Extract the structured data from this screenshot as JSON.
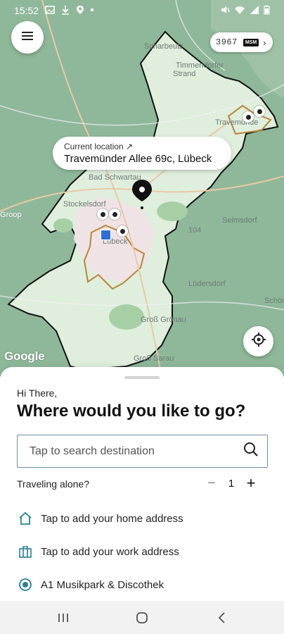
{
  "status_bar": {
    "time": "15:52",
    "left_icons": [
      "image-icon",
      "download-icon",
      "location-icon",
      "dot-icon"
    ],
    "right_icons": [
      "mute-icon",
      "wifi-icon",
      "signal-icon",
      "battery-icon"
    ]
  },
  "map": {
    "attribution": "Google",
    "place_labels": {
      "scharbeutz": "Scharbeutz",
      "timmendorfer": "Timmendorfer",
      "strand": "Strand",
      "travemunde": "Travemünde",
      "bad_schwartau": "Bad Schwartau",
      "stockelsdorf": "Stockelsdorf",
      "lubeck": "Lübeck",
      "selmsdorf": "Selmsdorf",
      "ludersdorf": "Lüdersdorf",
      "schoenberg": "Schön",
      "gross_gronau": "Groß Grönau",
      "gross_sarau": "Groß Sarau",
      "groop": "Groop",
      "road_104": "104"
    },
    "accent_colors": {
      "land": "#8fb89a",
      "service_area": "#dfeedd",
      "border": "#111111"
    }
  },
  "menu_button": {
    "icon": "hamburger-icon"
  },
  "credits": {
    "value": "3967",
    "badge": "MSM",
    "chevron": "›"
  },
  "location_bubble": {
    "label": "Current location ↗",
    "address": "Travemünder Allee 69c, Lübeck"
  },
  "recenter_button": {
    "icon": "crosshair-icon"
  },
  "sheet": {
    "greeting": "Hi There,",
    "headline": "Where would you like to go?",
    "search": {
      "placeholder": "Tap to search destination",
      "value": ""
    },
    "traveling_alone_label": "Traveling alone?",
    "passengers": {
      "minus": "−",
      "count": "1",
      "plus": "+"
    },
    "shortcuts": [
      {
        "icon": "home-icon",
        "label": "Tap to add your home address"
      },
      {
        "icon": "briefcase-icon",
        "label": "Tap to add your work address"
      },
      {
        "icon": "radio-pin-icon",
        "label": "A1 Musikpark & Discothek"
      }
    ],
    "icon_color": "#2a7f92"
  },
  "nav_bar": {
    "buttons": [
      "recents-button",
      "home-button",
      "back-button"
    ]
  }
}
